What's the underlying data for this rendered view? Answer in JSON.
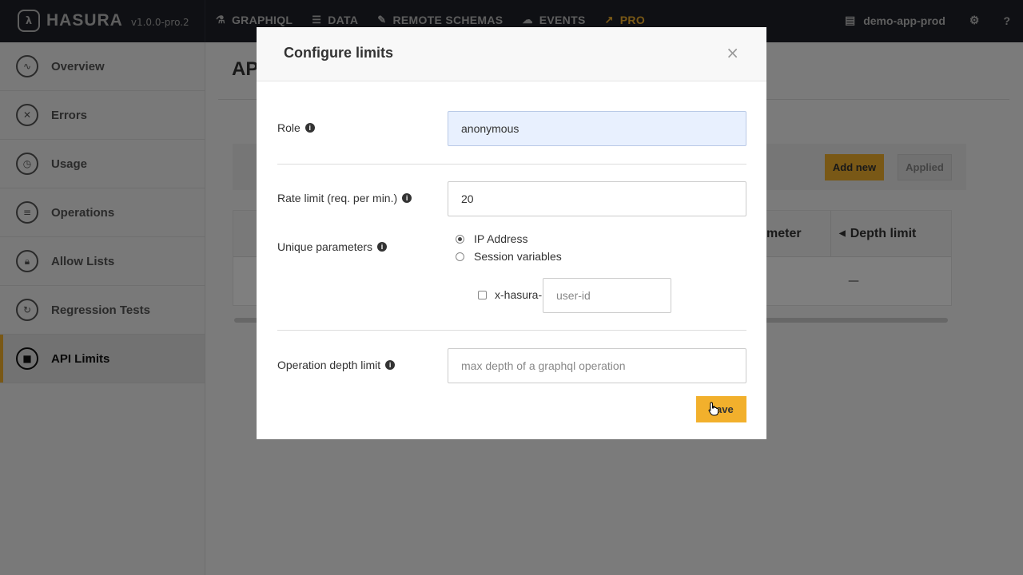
{
  "app": {
    "logo_text": "HASURA",
    "version": "v1.0.0-pro.2"
  },
  "nav": {
    "items": [
      {
        "label": "GRAPHIQL",
        "icon": "flask-icon"
      },
      {
        "label": "DATA",
        "icon": "database-icon"
      },
      {
        "label": "REMOTE SCHEMAS",
        "icon": "plug-icon"
      },
      {
        "label": "EVENTS",
        "icon": "cloud-icon"
      },
      {
        "label": "PRO",
        "icon": "chart-line-icon"
      }
    ],
    "project": "demo-app-prod",
    "help": "?"
  },
  "sidebar": {
    "items": [
      {
        "label": "Overview",
        "icon": "pulse-icon"
      },
      {
        "label": "Errors",
        "icon": "x-circle-icon"
      },
      {
        "label": "Usage",
        "icon": "clock-icon"
      },
      {
        "label": "Operations",
        "icon": "list-icon"
      },
      {
        "label": "Allow Lists",
        "icon": "lock-icon"
      },
      {
        "label": "Regression Tests",
        "icon": "refresh-icon"
      },
      {
        "label": "API Limits",
        "icon": "stop-icon"
      }
    ],
    "active_index": 6
  },
  "main": {
    "title_partial": "API",
    "add_new_label": "Add new",
    "applied_label": "Applied",
    "table": {
      "headers": [
        "meter",
        "Depth limit"
      ],
      "row": {
        "depth_limit": "—"
      }
    }
  },
  "modal": {
    "title": "Configure limits",
    "close": "×",
    "role": {
      "label": "Role",
      "value": "anonymous"
    },
    "rate_limit": {
      "label": "Rate limit (req. per min.)",
      "value": "20"
    },
    "unique_params": {
      "label": "Unique parameters",
      "options": [
        "IP Address",
        "Session variables"
      ],
      "selected": "IP Address",
      "header_prefix": "x-hasura-",
      "header_placeholder": "user-id"
    },
    "depth_limit": {
      "label": "Operation depth limit",
      "placeholder": "max depth of a graphql operation"
    },
    "save_label": "Save"
  },
  "colors": {
    "accent": "#f2b02c",
    "topbar": "#1f2129"
  }
}
